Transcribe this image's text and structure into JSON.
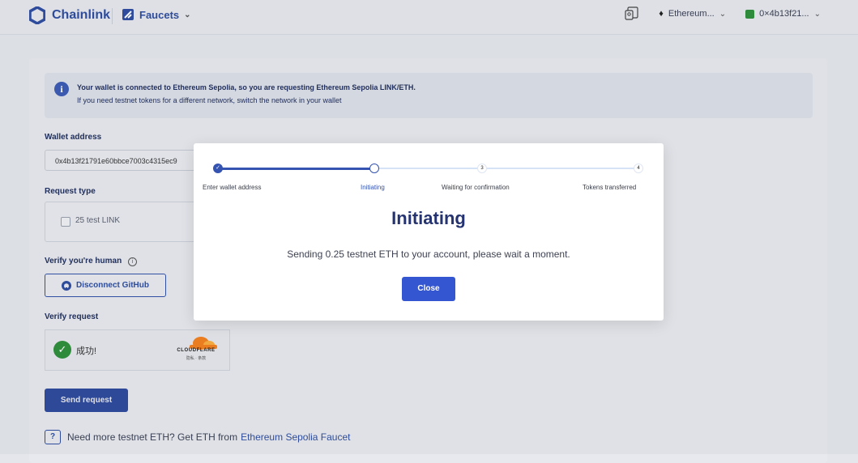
{
  "header": {
    "brand": "Chainlink",
    "section": "Faucets",
    "network": "Ethereum...",
    "wallet": "0×4b13f21...",
    "colors": {
      "brand": "#2f4ea0",
      "wallet_swatch": "#2e8f3c"
    }
  },
  "info_banner": {
    "line1": "Your wallet is connected to Ethereum Sepolia, so you are requesting Ethereum Sepolia LINK/ETH.",
    "line2": "If you need testnet tokens for a different network, switch the network in your wallet"
  },
  "form": {
    "wallet_label": "Wallet address",
    "wallet_value": "0x4b13f21791e60bbce7003c4315ec9",
    "request_type_label": "Request type",
    "request_option": "25 test LINK",
    "verify_human_label": "Verify you're human",
    "github_button": "Disconnect GitHub",
    "verify_request_label": "Verify request",
    "captcha_status": "成功!",
    "captcha_brand": "CLOUDFLARE",
    "captcha_links": "隐私 · 条款",
    "send_button": "Send request",
    "need_more_text": "Need more testnet ETH? Get ETH from",
    "need_more_link": "Ethereum Sepolia Faucet"
  },
  "modal": {
    "steps": [
      {
        "label": "Enter wallet address",
        "state": "done",
        "marker": "✓"
      },
      {
        "label": "Initiating",
        "state": "active",
        "marker": ""
      },
      {
        "label": "Waiting for confirmation",
        "state": "todo",
        "marker": "3"
      },
      {
        "label": "Tokens transferred",
        "state": "todo",
        "marker": "4"
      }
    ],
    "title": "Initiating",
    "message": "Sending 0.25 testnet ETH to your account, please wait a moment.",
    "close_button": "Close",
    "colors": {
      "accent": "#3553b0",
      "button": "#3456d1"
    }
  }
}
